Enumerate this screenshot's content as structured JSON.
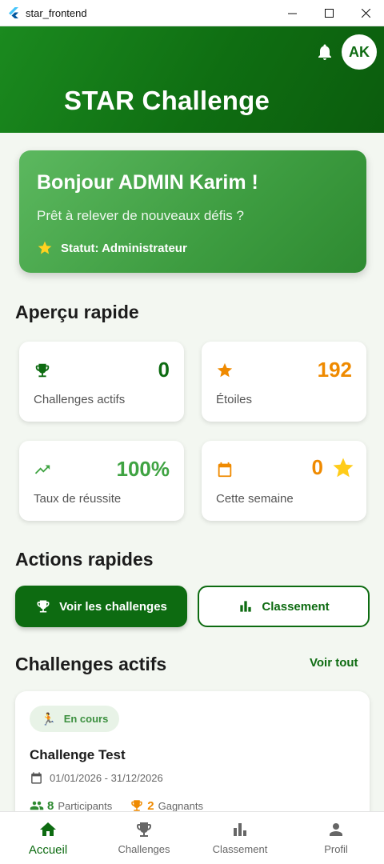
{
  "window": {
    "title": "star_frontend"
  },
  "header": {
    "title": "STAR Challenge",
    "avatar_initials": "AK"
  },
  "welcome": {
    "greeting": "Bonjour ADMIN Karim !",
    "subtitle": "Prêt à relever de nouveaux défis ?",
    "status": "Statut: Administrateur"
  },
  "overview": {
    "title": "Aperçu rapide",
    "stats": [
      {
        "value": "0",
        "label": "Challenges actifs",
        "icon": "trophy-icon",
        "color": "#0d6b11"
      },
      {
        "value": "192",
        "label": "Étoiles",
        "icon": "star-icon",
        "color": "#ef8a00"
      },
      {
        "value": "100%",
        "label": "Taux de réussite",
        "icon": "trending-up-icon",
        "color": "#3fa342"
      },
      {
        "value": "0",
        "label": "Cette semaine",
        "icon": "calendar-icon",
        "color": "#ef8a00"
      }
    ]
  },
  "actions": {
    "title": "Actions rapides",
    "view_challenges": "Voir les challenges",
    "leaderboard": "Classement"
  },
  "active_challenges": {
    "title": "Challenges actifs",
    "see_all": "Voir tout",
    "items": [
      {
        "status": "En cours",
        "title": "Challenge Test",
        "dates": "01/01/2026 - 31/12/2026",
        "participants_count": "8",
        "participants_label": "Participants",
        "winners_count": "2",
        "winners_label": "Gagnants"
      }
    ]
  },
  "bottom_nav": [
    {
      "label": "Accueil",
      "icon": "home-icon",
      "active": true
    },
    {
      "label": "Challenges",
      "icon": "trophy-icon",
      "active": false
    },
    {
      "label": "Classement",
      "icon": "bar-chart-icon",
      "active": false
    },
    {
      "label": "Profil",
      "icon": "person-icon",
      "active": false
    }
  ],
  "colors": {
    "primary": "#0d6b11",
    "accent": "#ef8a00",
    "success": "#3fa342"
  }
}
